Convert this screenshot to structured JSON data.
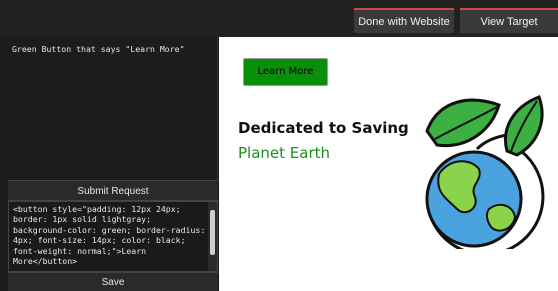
{
  "topbar": {
    "done_label": "Done with Website",
    "target_label": "View Target Mockup"
  },
  "left": {
    "prompt_text": "Green Button that says \"Learn More\"",
    "submit_label": "Submit Request",
    "code_text": "<button style=\"padding: 12px 24px; border: 1px solid lightgray; background-color: green; border-radius: 4px; font-size: 14px; color: black; font-weight: normal;\">Learn More</button>",
    "save_label": "Save"
  },
  "preview": {
    "button_label": "Learn More",
    "heading": "Dedicated to Saving",
    "subheading": "Planet Earth",
    "colors": {
      "button": "#0a8f0a",
      "subheading": "#1b8e1b"
    },
    "illustration": "earth-with-leaves-icon"
  }
}
